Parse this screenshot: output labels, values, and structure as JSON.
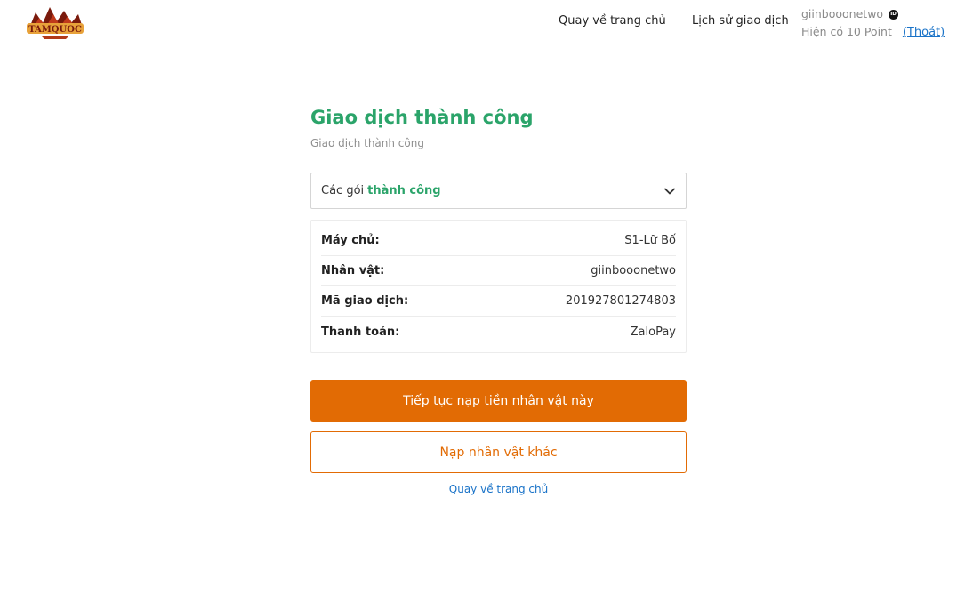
{
  "header": {
    "logo_alt": "TamQuocSo",
    "nav_home": "Quay về trang chủ",
    "nav_history": "Lịch sử giao dịch",
    "username": "giinbooonetwo",
    "id_icon_text": "ID",
    "points_text": "Hiện có 10 Point",
    "logout": "(Thoát)"
  },
  "main": {
    "title": "Giao dịch thành công",
    "subtitle": "Giao dịch thành công",
    "dropdown": {
      "prefix": "Các gói",
      "highlight": "thành công"
    },
    "details": [
      {
        "label": "Máy chủ:",
        "value": "S1-Lữ Bố"
      },
      {
        "label": "Nhân vật:",
        "value": "giinbooonetwo"
      },
      {
        "label": "Mã giao dịch:",
        "value": "201927801274803"
      },
      {
        "label": "Thanh toán:",
        "value": "ZaloPay"
      }
    ],
    "primary_button": "Tiếp tục nạp tiền nhân vật này",
    "secondary_button": "Nạp nhân vật khác",
    "back_link": "Quay về trang chủ"
  },
  "colors": {
    "accent_orange": "#e26b04",
    "success_green": "#2ba46a",
    "link_blue": "#1a73c8"
  }
}
